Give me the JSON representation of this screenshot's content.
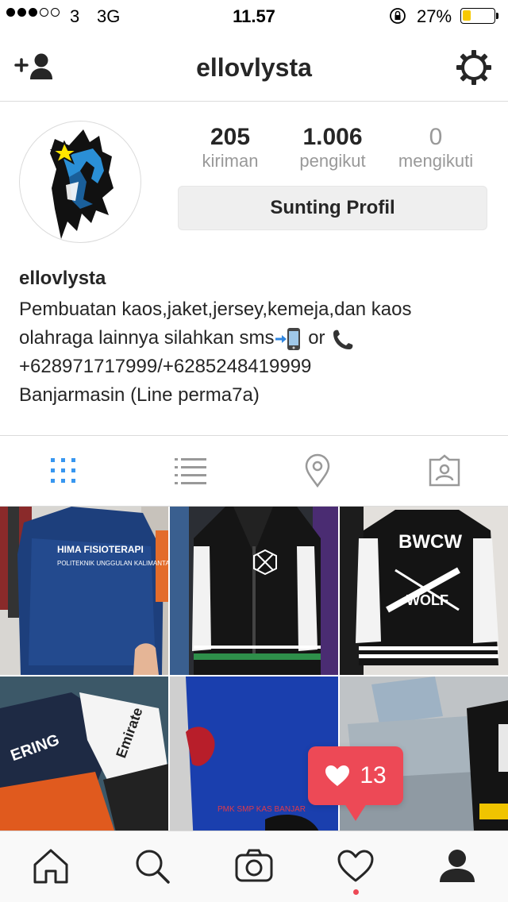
{
  "status_bar": {
    "carrier": "3",
    "network": "3G",
    "time": "11.57",
    "battery_percent_label": "27%",
    "battery_level": 0.27
  },
  "nav": {
    "username": "ellovlysta"
  },
  "profile": {
    "stats": [
      {
        "value": "205",
        "label": "kiriman"
      },
      {
        "value": "1.006",
        "label": "pengikut"
      },
      {
        "value": "0",
        "label": "mengikuti"
      }
    ],
    "edit_button_label": "Sunting Profil",
    "name": "ellovlysta",
    "bio_line1": "Pembuatan kaos,jaket,jersey,kemeja,dan kaos",
    "bio_line2a": "olahraga lainnya silahkan sms",
    "bio_line2b": "or",
    "bio_line3": "+628971717999/+6285248419999",
    "bio_line4": "Banjarmasin (Line perma7a)"
  },
  "tabs": [
    {
      "name": "grid-view",
      "icon": "grid-icon",
      "active": true
    },
    {
      "name": "list-view",
      "icon": "list-icon",
      "active": false
    },
    {
      "name": "photo-map",
      "icon": "location-pin-icon",
      "active": false
    },
    {
      "name": "tagged-photos",
      "icon": "tagged-person-icon",
      "active": false
    }
  ],
  "posts": [
    {
      "caption_text": "HIMA FISIOTERAPI",
      "sub_text": "POLITEKNIK UNGGULAN KALIMANTAN"
    },
    {
      "caption_text": "",
      "sub_text": ""
    },
    {
      "caption_text": "BWCW",
      "sub_text": "WOLF"
    },
    {
      "caption_text": "",
      "sub_text": ""
    },
    {
      "caption_text": "",
      "sub_text": ""
    },
    {
      "caption_text": "",
      "sub_text": ""
    }
  ],
  "like_popup": {
    "count": "13",
    "icon": "heart-icon"
  },
  "tab_bar": [
    {
      "name": "home",
      "icon": "home-icon"
    },
    {
      "name": "search",
      "icon": "search-icon"
    },
    {
      "name": "camera",
      "icon": "camera-icon"
    },
    {
      "name": "activity",
      "icon": "heart-outline-icon"
    },
    {
      "name": "profile",
      "icon": "profile-icon"
    }
  ],
  "colors": {
    "accent_blue": "#3897f0",
    "like_red": "#ed4956",
    "battery_yellow": "#f7c900"
  }
}
